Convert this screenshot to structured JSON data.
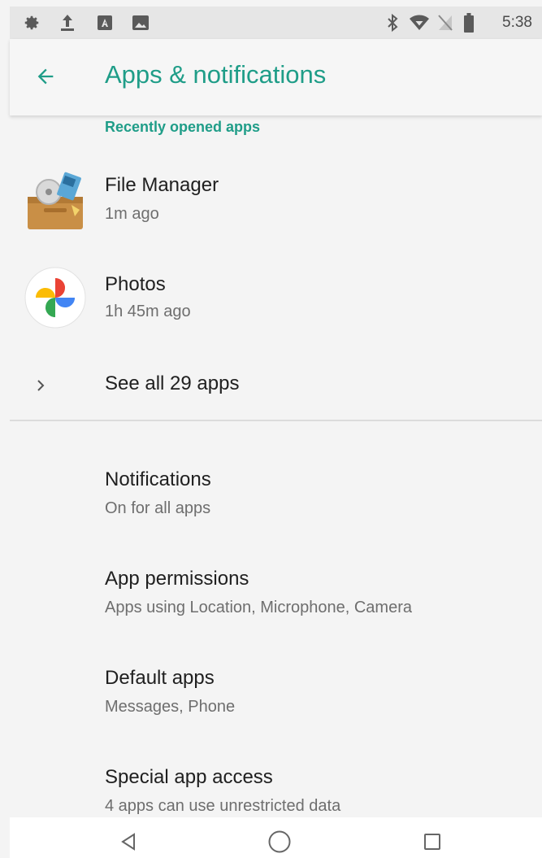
{
  "status_bar": {
    "time": "5:38",
    "left_icons": [
      "gear-icon",
      "upload-icon",
      "app-a-icon",
      "image-icon"
    ],
    "right_icons": [
      "bluetooth-icon",
      "wifi-icon",
      "no-sim-icon",
      "battery-icon"
    ]
  },
  "app_bar": {
    "title": "Apps & notifications",
    "back_icon": "arrow-left-icon"
  },
  "recent": {
    "header": "Recently opened apps",
    "apps": [
      {
        "name": "File Manager",
        "time": "1m ago",
        "icon": "file-manager-icon"
      },
      {
        "name": "Photos",
        "time": "1h 45m ago",
        "icon": "photos-icon"
      }
    ],
    "see_all": "See all 29 apps"
  },
  "settings": [
    {
      "title": "Notifications",
      "subtitle": "On for all apps"
    },
    {
      "title": "App permissions",
      "subtitle": "Apps using Location, Microphone, Camera"
    },
    {
      "title": "Default apps",
      "subtitle": "Messages, Phone"
    },
    {
      "title": "Special app access",
      "subtitle": "4 apps can use unrestricted data"
    }
  ],
  "nav_bar": {
    "icons": [
      "back-triangle-icon",
      "home-circle-icon",
      "recents-square-icon"
    ]
  },
  "colors": {
    "accent": "#1f9d88",
    "background": "#f4f4f4",
    "primary_text": "#202020",
    "secondary_text": "#6e6e6e"
  }
}
